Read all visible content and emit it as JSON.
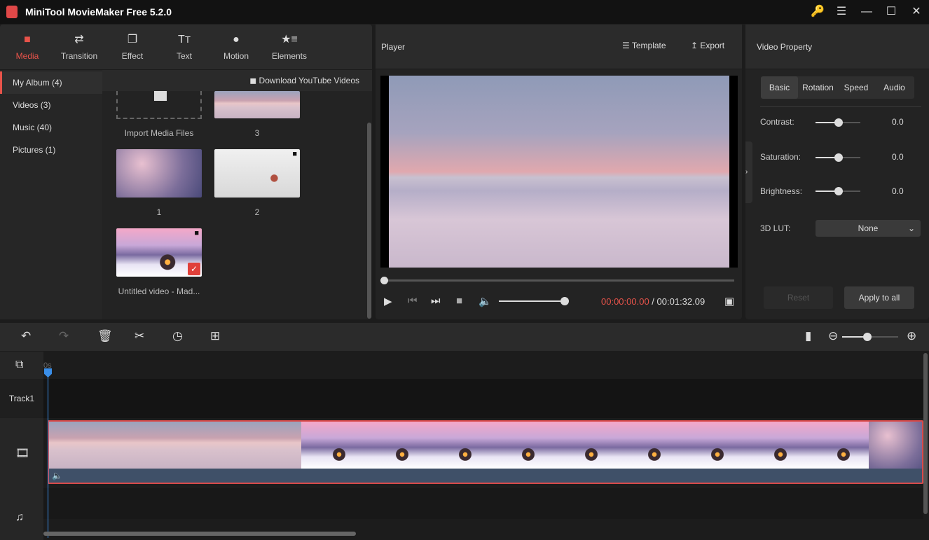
{
  "app": {
    "title": "MiniTool MovieMaker Free 5.2.0",
    "window_buttons": [
      "key-icon",
      "menu-icon",
      "minimize-icon",
      "maximize-icon",
      "close-icon"
    ]
  },
  "tabs": [
    {
      "label": "Media",
      "icon": "folder-icon",
      "active": true
    },
    {
      "label": "Transition",
      "icon": "swap-icon"
    },
    {
      "label": "Effect",
      "icon": "effect-icon"
    },
    {
      "label": "Text",
      "icon": "text-icon"
    },
    {
      "label": "Motion",
      "icon": "motion-icon"
    },
    {
      "label": "Elements",
      "icon": "elements-icon"
    }
  ],
  "sidebar": {
    "items": [
      {
        "label": "My Album (4)",
        "active": true
      },
      {
        "label": "Videos (3)"
      },
      {
        "label": "Music (40)"
      },
      {
        "label": "Pictures (1)"
      }
    ]
  },
  "media": {
    "download_label": "Download YouTube Videos",
    "items": [
      {
        "caption": "Import Media Files"
      },
      {
        "caption": "3"
      },
      {
        "caption": "1"
      },
      {
        "caption": "2"
      },
      {
        "caption": "Untitled video - Mad..."
      }
    ]
  },
  "player": {
    "title": "Player",
    "template_label": "Template",
    "export_label": "Export",
    "current_time": "00:00:00.00",
    "separator": " / ",
    "total_time": "00:01:32.09",
    "volume": 0.8,
    "progress": 0
  },
  "property": {
    "title": "Video Property",
    "tabs": [
      "Basic",
      "Rotation",
      "Speed",
      "Audio"
    ],
    "active_tab": "Basic",
    "rows": [
      {
        "label": "Contrast:",
        "value": "0.0"
      },
      {
        "label": "Saturation:",
        "value": "0.0"
      },
      {
        "label": "Brightness:",
        "value": "0.0"
      }
    ],
    "lut_label": "3D LUT:",
    "lut_value": "None",
    "reset_label": "Reset",
    "apply_label": "Apply to all"
  },
  "timeline": {
    "ruler_start": "0s",
    "track1_label": "Track1",
    "zoom": 0.5
  },
  "colors": {
    "accent": "#e8534a",
    "playhead": "#3a8ee8"
  }
}
